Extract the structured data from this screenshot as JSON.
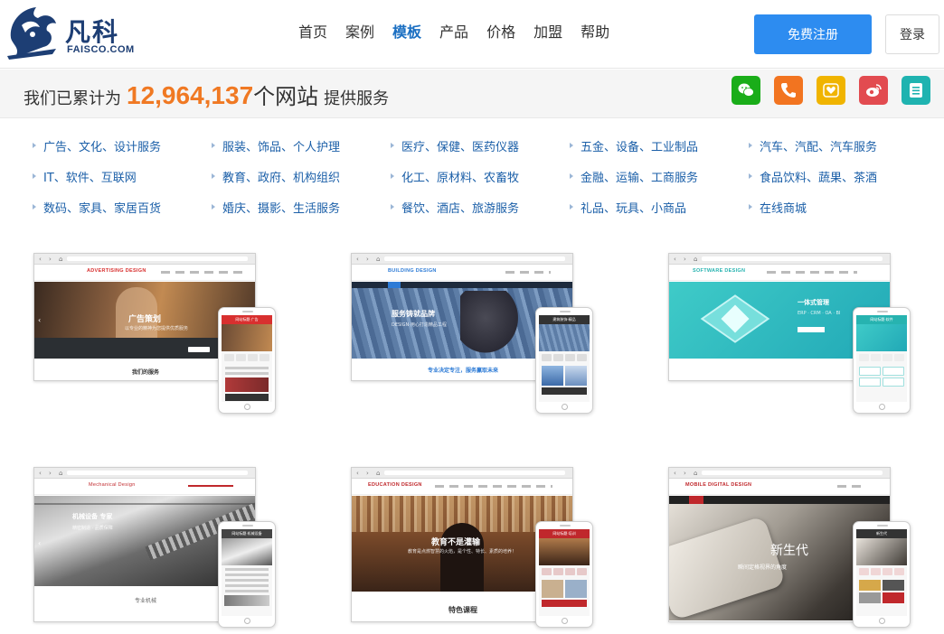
{
  "brand": {
    "name": "凡科",
    "domain": "FAISCO.COM"
  },
  "nav": [
    {
      "label": "首页",
      "active": false
    },
    {
      "label": "案例",
      "active": false
    },
    {
      "label": "模板",
      "active": true
    },
    {
      "label": "产品",
      "active": false
    },
    {
      "label": "价格",
      "active": false
    },
    {
      "label": "加盟",
      "active": false
    },
    {
      "label": "帮助",
      "active": false
    }
  ],
  "actions": {
    "register": "免费注册",
    "login": "登录"
  },
  "stat": {
    "prefix": "我们已累计为",
    "count": "12,964,137",
    "unit": "个网站",
    "suffix": "提供服务"
  },
  "social": [
    {
      "icon": "wechat-icon",
      "color": "#1aad19"
    },
    {
      "icon": "phone-icon",
      "color": "#f27420"
    },
    {
      "icon": "heart-icon",
      "color": "#f0b400"
    },
    {
      "icon": "weibo-icon",
      "color": "#e24b50"
    },
    {
      "icon": "form-icon",
      "color": "#1fb3b0"
    }
  ],
  "categories": [
    [
      "广告、文化、设计服务",
      "服装、饰品、个人护理",
      "医疗、保健、医药仪器",
      "五金、设备、工业制品",
      "汽车、汽配、汽车服务"
    ],
    [
      "IT、软件、互联网",
      "教育、政府、机构组织",
      "化工、原材料、农畜牧",
      "金融、运输、工商服务",
      "食品饮料、蔬果、茶酒"
    ],
    [
      "数码、家具、家居百货",
      "婚庆、摄影、生活服务",
      "餐饮、酒店、旅游服务",
      "礼品、玩具、小商品",
      "在线商城"
    ]
  ],
  "templates": [
    {
      "logo": "ADVERTISING DESIGN",
      "logo_color": "#d8302f",
      "hero_title": "广告策划",
      "hero_sub": "以专业的精神为您提供优质服务",
      "footer": "我们的服务",
      "phone_head": "网站标题·广告",
      "phone_color": "#d8302f"
    },
    {
      "logo": "BUILDING DESIGN",
      "logo_color": "#2d7bd6",
      "hero_title": "服务铸就品牌",
      "hero_sub": "DESIGN·用心打造精品工程",
      "footer": "专业决定专注，服务赢取未来",
      "phone_head": "建筑装饰·精品",
      "phone_color": "#333333"
    },
    {
      "logo": "SOFTWARE DESIGN",
      "logo_color": "#27b3b0",
      "hero_title": "一体式管理",
      "hero_sub": "ERP · CRM · OA · BI",
      "footer": "",
      "phone_head": "网站标题·软件",
      "phone_color": "#27b3b0"
    },
    {
      "logo": "Mechanical Design",
      "logo_color": "#c0282c",
      "hero_title": "机械设备 专家",
      "hero_sub": "精密制造 · 品质保障",
      "footer": "专业机械",
      "phone_head": "网站标题·机械设备",
      "phone_color": "#444444"
    },
    {
      "logo": "EDUCATION DESIGN",
      "logo_color": "#c0282c",
      "hero_title": "教育不是灌输",
      "hero_sub": "教育是点燃智慧的火焰，是个性、特长、素质的培养！",
      "footer": "特色课程",
      "phone_head": "网站标题·培训",
      "phone_color": "#c0282c"
    },
    {
      "logo": "MOBILE DIGITAL DESIGN",
      "logo_color": "#c0282c",
      "hero_title": "新生代",
      "hero_sub": "瞬间定格视界的角度",
      "footer": "",
      "phone_head": "新生代",
      "phone_color": "#333333"
    }
  ]
}
